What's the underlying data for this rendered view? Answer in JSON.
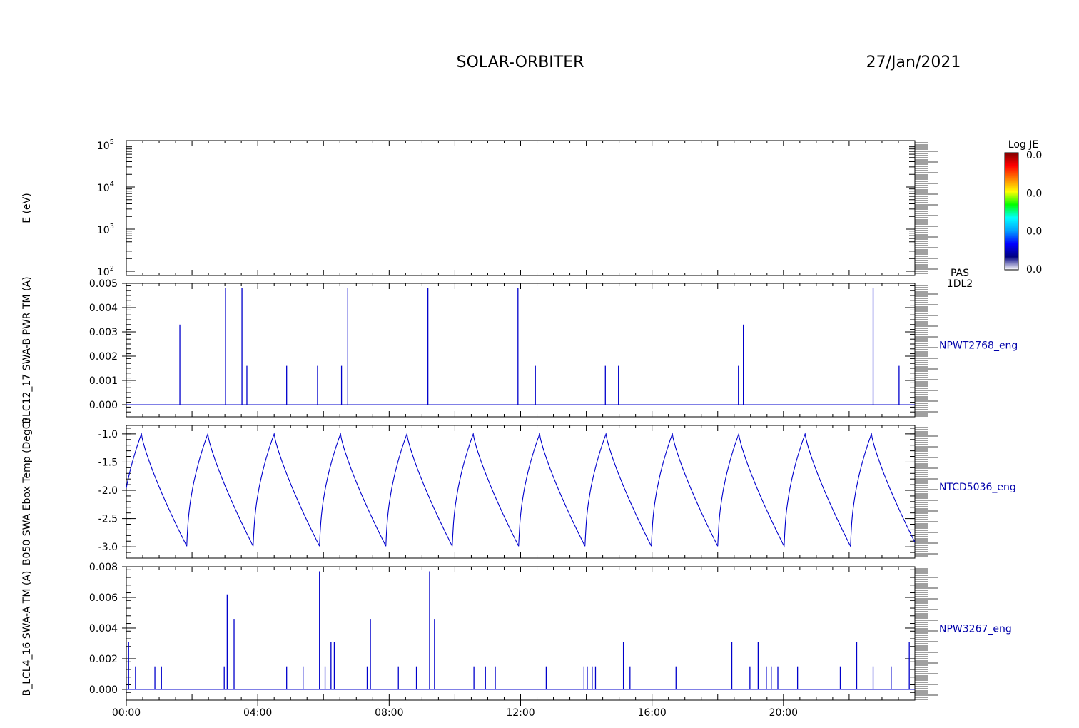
{
  "header": {
    "mission": "SOLAR-ORBITER",
    "date": "27/Jan/2021"
  },
  "x_ticks": [
    "00:00",
    "04:00",
    "08:00",
    "12:00",
    "16:00",
    "20:00"
  ],
  "colorbar": {
    "title": "Log JE",
    "ticks": [
      "0.0",
      "0.0",
      "0.0",
      "0.0"
    ],
    "colors": [
      "#ffffff",
      "#000080",
      "#0000ff",
      "#00a0ff",
      "#00ffff",
      "#00ff00",
      "#ffff00",
      "#ff8000",
      "#ff0000",
      "#800000"
    ]
  },
  "panels": [
    {
      "ylabel": "E (eV)",
      "right_label": "PAS\n1DL2",
      "ytick_bases": [
        "10",
        "10",
        "10",
        "10"
      ],
      "ytick_exps": [
        "2",
        "3",
        "4",
        "5"
      ]
    },
    {
      "ylabel": "BLC12_17 SWA-B PWR TM (A)",
      "right_label": "NPWT2768_eng",
      "ytick_labels": [
        "0.000",
        "0.001",
        "0.002",
        "0.003",
        "0.004",
        "0.005"
      ]
    },
    {
      "ylabel": "B050 SWA Ebox Temp (DegC)",
      "right_label": "NTCD5036_eng",
      "ytick_labels": [
        "-3.0",
        "-2.5",
        "-2.0",
        "-1.5",
        "-1.0"
      ]
    },
    {
      "ylabel": "B_LCL4_16 SWA-A TM (A)",
      "right_label": "NPW3267_eng",
      "ytick_labels": [
        "0.000",
        "0.002",
        "0.004",
        "0.006",
        "0.008"
      ]
    }
  ],
  "chart_data": [
    {
      "type": "heatmap",
      "title": "SOLAR-ORBITER",
      "ylabel": "E (eV)",
      "yscale": "log",
      "ylim": [
        100,
        100000
      ],
      "xlim": [
        "00:00",
        "24:00"
      ],
      "colorbar_label": "Log JE",
      "values": []
    },
    {
      "type": "line",
      "ylabel": "BLC12_17 SWA-B PWR TM (A)",
      "xlim_hours": [
        0,
        24
      ],
      "ylim": [
        -0.0005,
        0.005
      ],
      "baseline": 0.0,
      "spikes_hours": [
        1.63,
        3.02,
        3.52,
        3.67,
        4.88,
        5.82,
        6.55,
        6.74,
        9.18,
        11.92,
        12.45,
        14.58,
        14.98,
        18.63,
        18.78,
        22.73,
        23.52
      ],
      "spikes_values": [
        0.0033,
        0.0048,
        0.0048,
        0.0016,
        0.0016,
        0.0016,
        0.0016,
        0.0048,
        0.0048,
        0.0048,
        0.0016,
        0.0016,
        0.0016,
        0.0016,
        0.0033,
        0.0048,
        0.0016
      ]
    },
    {
      "type": "line",
      "ylabel": "B050 SWA Ebox Temp (DegC)",
      "xlim_hours": [
        0,
        24
      ],
      "ylim": [
        -3.2,
        -0.85
      ],
      "cycle_start": -0.17,
      "cycle_period_hours": 2.02,
      "cycle_rise_hours": 0.63,
      "min": -3.0,
      "max": -1.0
    },
    {
      "type": "line",
      "ylabel": "B_LCL4_16 SWA-A TM (A)",
      "xlim_hours": [
        0,
        24
      ],
      "ylim": [
        -0.0007,
        0.008
      ],
      "baseline": 0.0,
      "spikes_hours": [
        0.07,
        0.28,
        0.87,
        1.07,
        2.98,
        3.07,
        3.28,
        4.88,
        5.38,
        5.88,
        6.05,
        6.23,
        6.33,
        7.33,
        7.43,
        8.28,
        8.83,
        9.23,
        9.38,
        10.58,
        10.93,
        11.23,
        12.78,
        13.93,
        14.03,
        14.18,
        14.28,
        15.13,
        15.33,
        16.73,
        18.43,
        18.98,
        19.23,
        19.48,
        19.63,
        19.83,
        20.43,
        21.73,
        22.23,
        22.73,
        23.28,
        23.83
      ],
      "spikes_values": [
        0.0031,
        0.0015,
        0.0015,
        0.0015,
        0.0015,
        0.0062,
        0.0046,
        0.0015,
        0.0015,
        0.0077,
        0.0015,
        0.0031,
        0.0031,
        0.0015,
        0.0046,
        0.0015,
        0.0015,
        0.0077,
        0.0046,
        0.0015,
        0.0015,
        0.0015,
        0.0015,
        0.0015,
        0.0015,
        0.0015,
        0.0015,
        0.0031,
        0.0015,
        0.0015,
        0.0031,
        0.0015,
        0.0031,
        0.0015,
        0.0015,
        0.0015,
        0.0015,
        0.0015,
        0.0031,
        0.0015,
        0.0015,
        0.0031
      ]
    }
  ],
  "style": {
    "axis_color": "#000000",
    "trace_color": "#0000cc",
    "label_color": "#0000aa"
  }
}
